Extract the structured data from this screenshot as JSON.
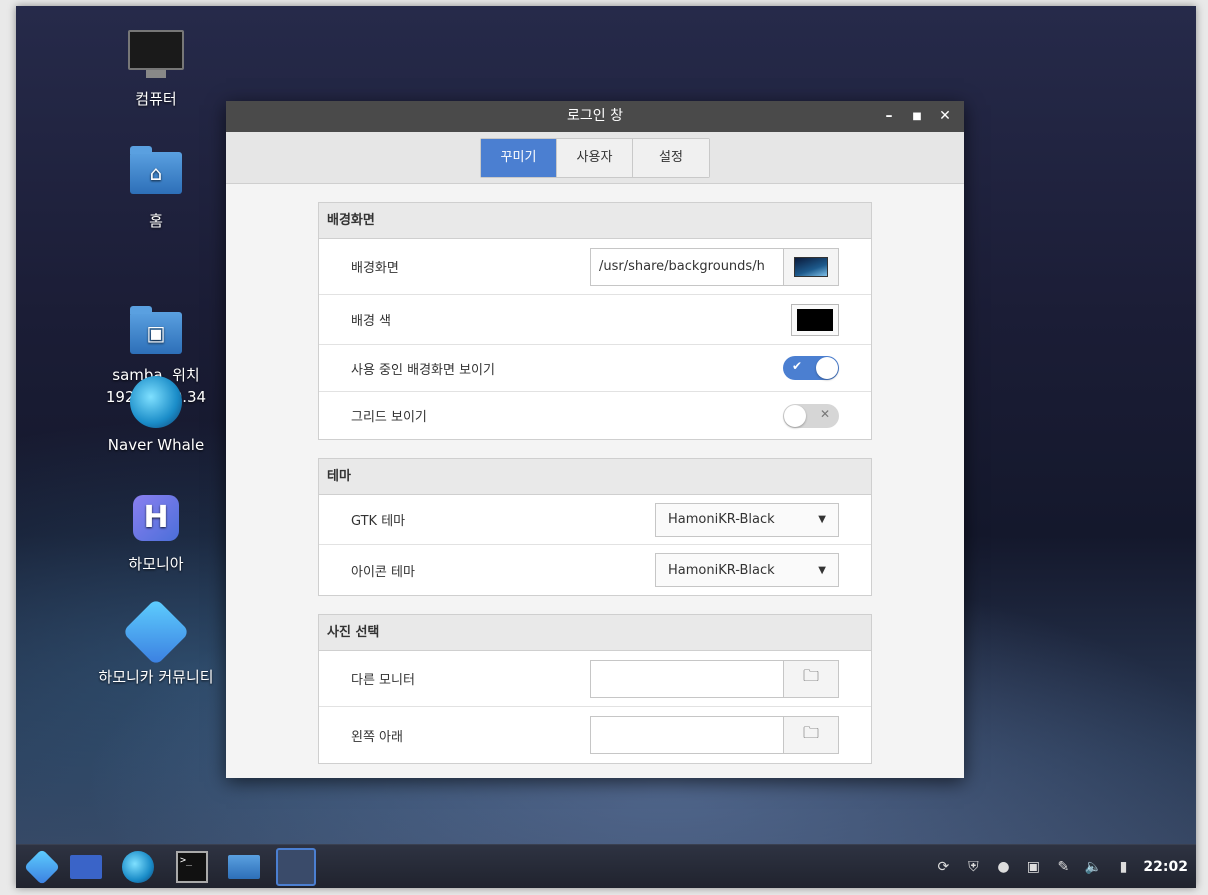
{
  "desktop": {
    "icons": [
      {
        "label": "컴퓨터"
      },
      {
        "label": "홈"
      },
      {
        "label": "samba, 위치\n192.168.0.34"
      },
      {
        "label": "Naver Whale"
      },
      {
        "label": "하모니아"
      },
      {
        "label": "하모니카 커뮤니티"
      }
    ]
  },
  "window": {
    "title": "로그인 창",
    "controls": {
      "minimize": "–",
      "maximize": "■",
      "close": "✕"
    },
    "tabs": [
      {
        "label": "꾸미기",
        "active": true
      },
      {
        "label": "사용자",
        "active": false
      },
      {
        "label": "설정",
        "active": false
      }
    ],
    "background_section": {
      "header": "배경화면",
      "wallpaper_label": "배경화면",
      "wallpaper_path": "/usr/share/backgrounds/h",
      "color_label": "배경 색",
      "color_value": "#000000",
      "show_current_label": "사용 중인 배경화면 보이기",
      "show_current_on": true,
      "show_grid_label": "그리드 보이기",
      "show_grid_on": false
    },
    "theme_section": {
      "header": "테마",
      "gtk_label": "GTK 테마",
      "gtk_value": "HamoniKR-Black",
      "icon_label": "아이콘 테마",
      "icon_value": "HamoniKR-Black"
    },
    "photo_section": {
      "header": "사진 선택",
      "other_monitor_label": "다른 모니터",
      "other_monitor_value": "",
      "bottom_left_label": "왼쪽 아래",
      "bottom_left_value": ""
    }
  },
  "taskbar": {
    "clock": "22:02"
  },
  "colors": {
    "accent": "#4b7fd1",
    "titlebar": "#4a4a4a"
  }
}
